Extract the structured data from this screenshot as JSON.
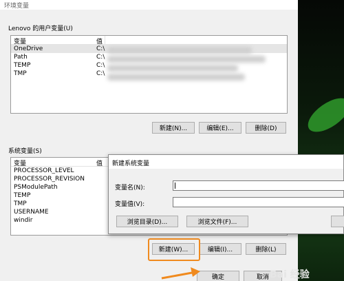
{
  "window": {
    "title": "环境变量"
  },
  "user_vars": {
    "group_label": "Lenovo 的用户变量(U)",
    "col_var": "变量",
    "col_value": "值",
    "rows": [
      {
        "name": "OneDrive",
        "value": "C:\\"
      },
      {
        "name": "Path",
        "value": "C:\\"
      },
      {
        "name": "TEMP",
        "value": "C:\\"
      },
      {
        "name": "TMP",
        "value": "C:\\"
      }
    ],
    "buttons": {
      "new": "新建(N)...",
      "edit": "编辑(E)...",
      "delete": "删除(D)"
    }
  },
  "system_vars": {
    "group_label": "系统变量(S)",
    "col_var": "变量",
    "col_value": "值",
    "rows": [
      {
        "name": "PROCESSOR_LEVEL"
      },
      {
        "name": "PROCESSOR_REVISION"
      },
      {
        "name": "PSModulePath"
      },
      {
        "name": "TEMP"
      },
      {
        "name": "TMP"
      },
      {
        "name": "USERNAME"
      },
      {
        "name": "windir"
      }
    ],
    "buttons": {
      "new": "新建(W)...",
      "edit": "编辑(I)...",
      "delete": "删除(L)"
    }
  },
  "footer": {
    "ok": "确定",
    "cancel": "取消"
  },
  "new_var_dialog": {
    "title": "新建系统变量",
    "name_label": "变量名(N):",
    "value_label": "变量值(V):",
    "name_value": "",
    "value_value": "",
    "browse_dir": "浏览目录(D)...",
    "browse_file": "浏览文件(F)..."
  },
  "watermark": {
    "text": "Bai 经验"
  },
  "accent_color": "#f08a1e"
}
